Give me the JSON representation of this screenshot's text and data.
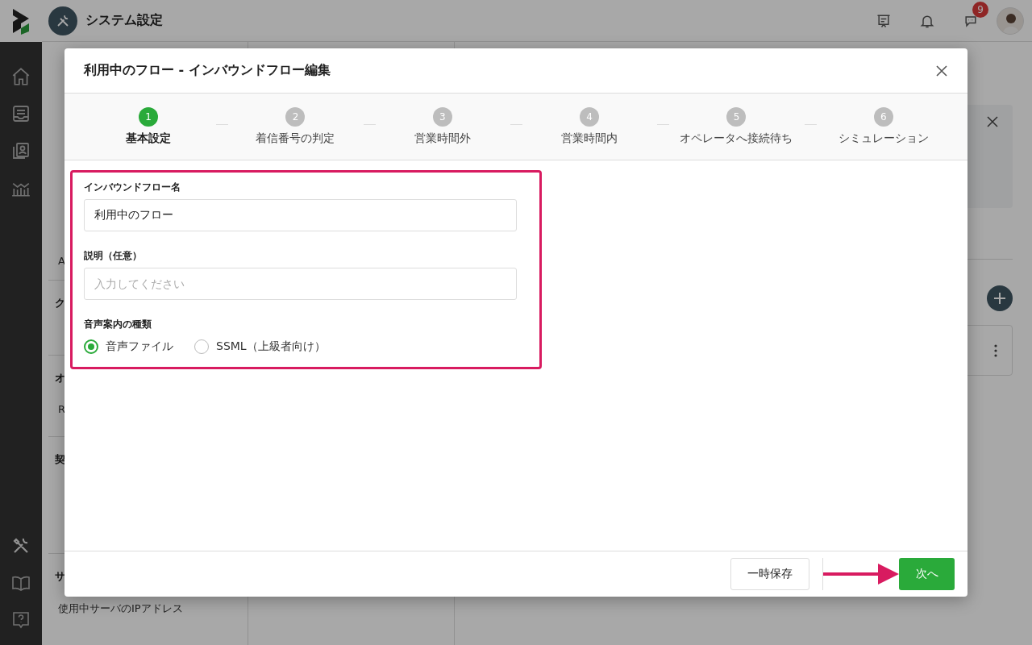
{
  "header": {
    "title": "システム設定",
    "badge": "9"
  },
  "sidebar": {
    "groups": [
      {
        "items": [
          {
            "label": "A"
          }
        ]
      },
      {
        "heading": "ク"
      },
      {
        "heading": "オ",
        "items": [
          {
            "label": "R"
          }
        ]
      },
      {
        "heading": "契"
      },
      {
        "heading": "サ",
        "items": [
          {
            "label": "使用中サーバのIPアドレス"
          }
        ]
      }
    ]
  },
  "modal": {
    "title": "利用中のフロー - インバウンドフロー編集",
    "steps": [
      {
        "number": "1",
        "label": "基本設定",
        "selected": true
      },
      {
        "number": "2",
        "label": "着信番号の判定",
        "selected": false
      },
      {
        "number": "3",
        "label": "営業時間外",
        "selected": false
      },
      {
        "number": "4",
        "label": "営業時間内",
        "selected": false
      },
      {
        "number": "5",
        "label": "オペレータへ接続待ち",
        "selected": false
      },
      {
        "number": "6",
        "label": "シミュレーション",
        "selected": false
      }
    ],
    "name_field": {
      "label": "インバウンドフロー名",
      "value": "利用中のフロー"
    },
    "description_field": {
      "label": "説明（任意）",
      "placeholder": "入力してください"
    },
    "voice_type": {
      "label": "音声案内の種類",
      "options": [
        {
          "label": "音声ファイル",
          "selected": true
        },
        {
          "label": "SSML（上級者向け）",
          "selected": false
        }
      ]
    },
    "buttons": {
      "save": "一時保存",
      "next": "次へ"
    }
  }
}
